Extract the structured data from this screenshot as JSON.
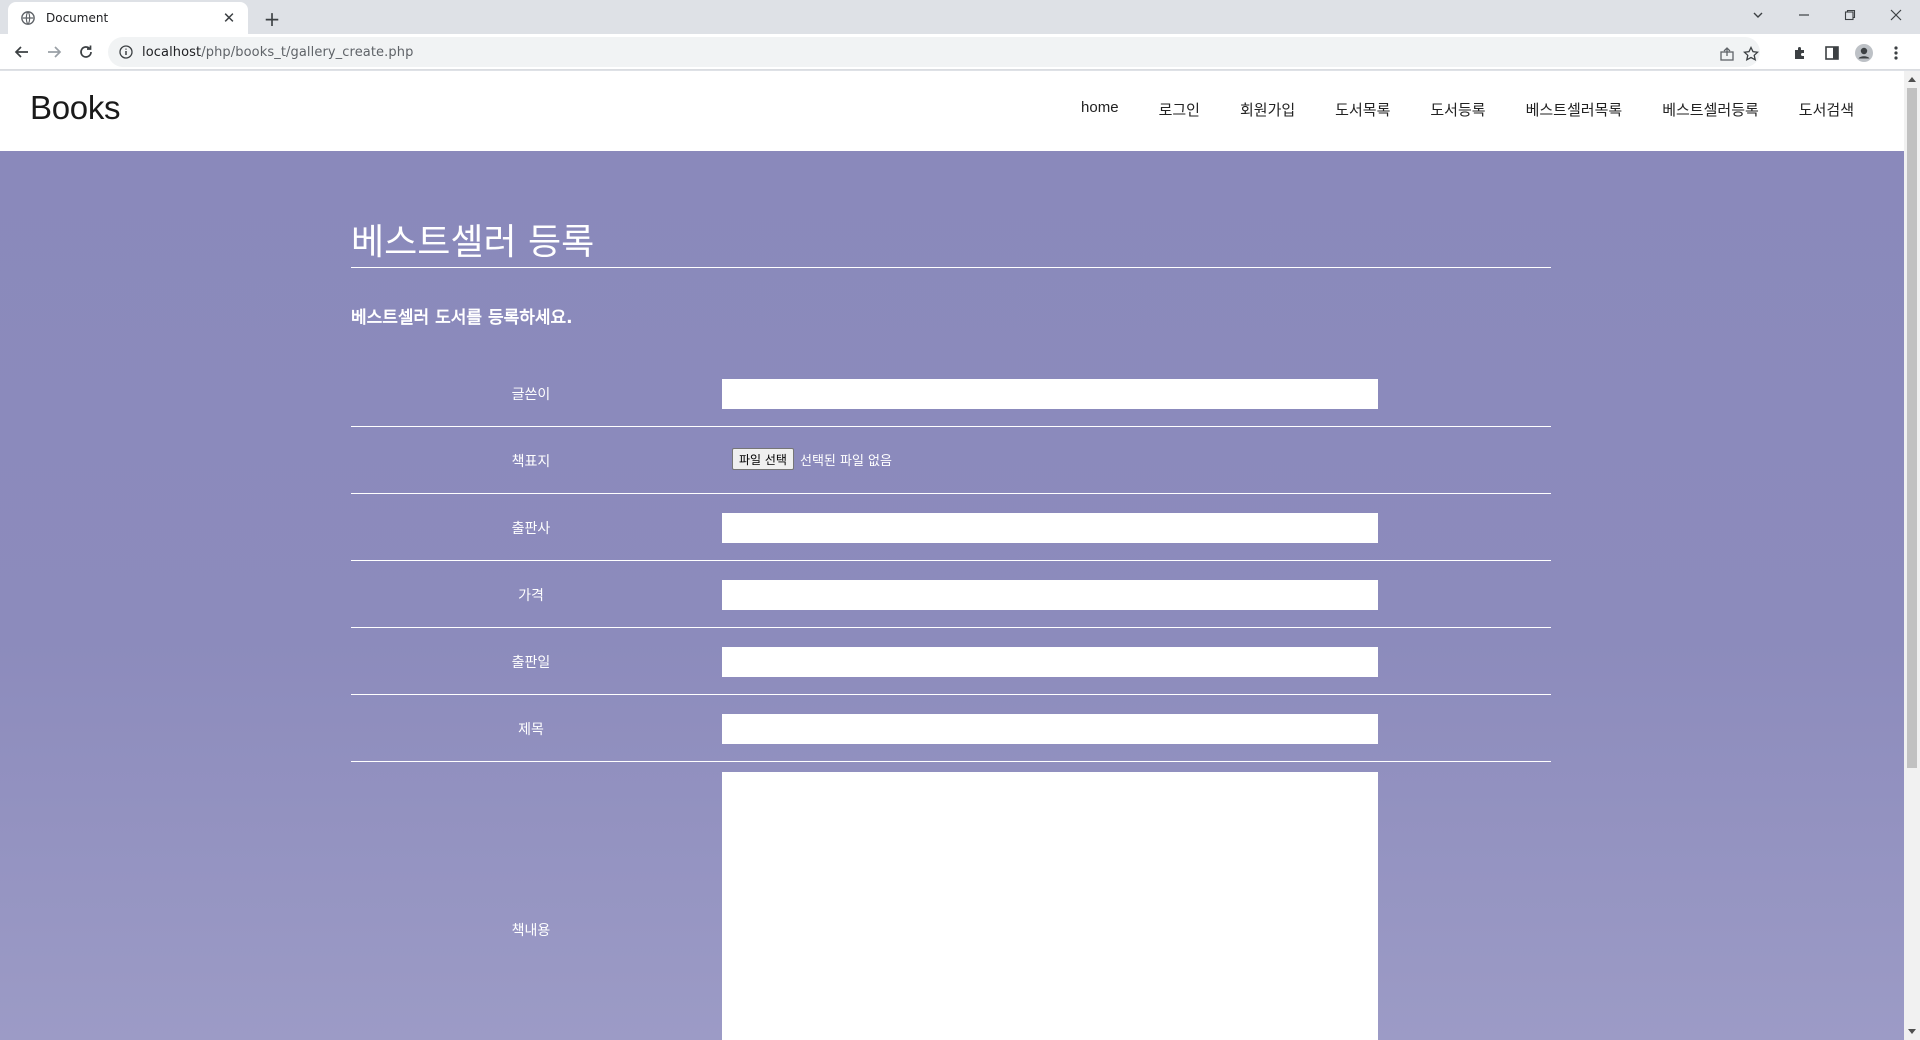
{
  "browser": {
    "tab_title": "Document",
    "new_tab": "+",
    "url_host": "localhost",
    "url_path": "/php/books_t/gallery_create.php"
  },
  "site": {
    "logo": "Books",
    "nav": [
      "home",
      "로그인",
      "회원가입",
      "도서목록",
      "도서등록",
      "베스트셀러목록",
      "베스트셀러등록",
      "도서검색"
    ]
  },
  "page": {
    "title": "베스트셀러 등록",
    "subtitle": "베스트셀러 도서를 등록하세요."
  },
  "form": {
    "author_label": "글쓴이",
    "author_value": "",
    "cover_label": "책표지",
    "cover_button": "파일 선택",
    "cover_status": "선택된 파일 없음",
    "publisher_label": "출판사",
    "publisher_value": "",
    "price_label": "가격",
    "price_value": "",
    "pubdate_label": "출판일",
    "pubdate_value": "",
    "title_label": "제목",
    "title_value": "",
    "content_label": "책내용",
    "content_value": ""
  }
}
